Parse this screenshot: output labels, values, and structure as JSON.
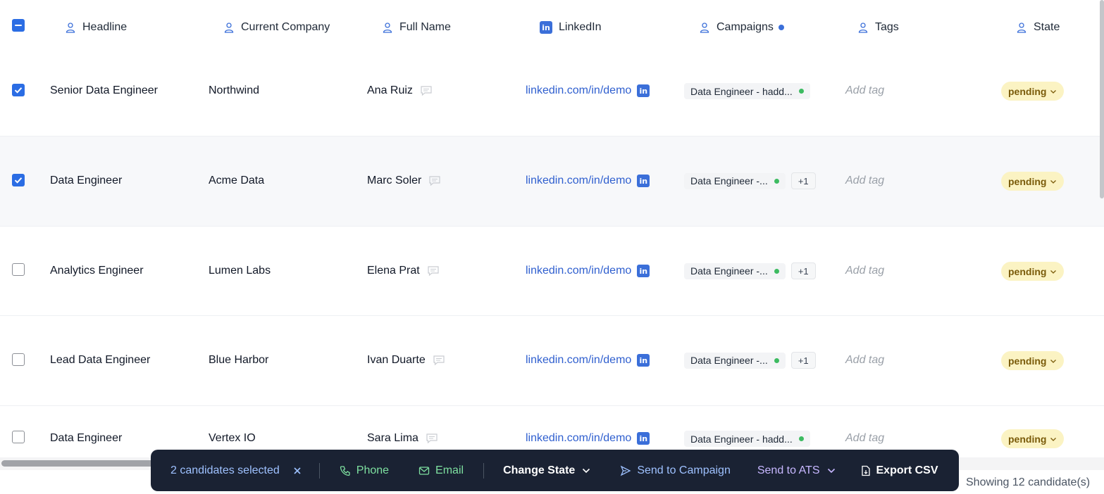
{
  "header": {
    "columns": [
      {
        "label": "Headline",
        "icon": "person-icon"
      },
      {
        "label": "Current Company",
        "icon": "person-icon"
      },
      {
        "label": "Full Name",
        "icon": "person-icon"
      },
      {
        "label": "LinkedIn",
        "icon": "linkedin-icon"
      },
      {
        "label": "Campaigns",
        "icon": "person-icon"
      },
      {
        "label": "Tags",
        "icon": "person-icon"
      },
      {
        "label": "State",
        "icon": "person-icon"
      }
    ],
    "linkedin_badge": "in"
  },
  "rows": [
    {
      "checked": true,
      "headline": "Senior Data Engineer",
      "company": "Northwind",
      "name": "Ana Ruiz",
      "linkedin": "linkedin.com/in/demo",
      "campaign": "Data Engineer - hadd...",
      "extra": "",
      "tag": "Add tag",
      "state": "pending"
    },
    {
      "checked": true,
      "headline": "Data Engineer",
      "company": "Acme Data",
      "name": "Marc Soler",
      "linkedin": "linkedin.com/in/demo",
      "campaign": "Data Engineer -...",
      "extra": "+1",
      "tag": "Add tag",
      "state": "pending"
    },
    {
      "checked": false,
      "headline": "Analytics Engineer",
      "company": "Lumen Labs",
      "name": "Elena Prat",
      "linkedin": "linkedin.com/in/demo",
      "campaign": "Data Engineer -...",
      "extra": "+1",
      "tag": "Add tag",
      "state": "pending"
    },
    {
      "checked": false,
      "headline": "Lead Data Engineer",
      "company": "Blue Harbor",
      "name": "Ivan Duarte",
      "linkedin": "linkedin.com/in/demo",
      "campaign": "Data Engineer -...",
      "extra": "+1",
      "tag": "Add tag",
      "state": "pending"
    },
    {
      "checked": false,
      "headline": "Data Engineer",
      "company": "Vertex IO",
      "name": "Sara Lima",
      "linkedin": "linkedin.com/in/demo",
      "campaign": "Data Engineer - hadd...",
      "extra": "",
      "tag": "Add tag",
      "state": "pending"
    }
  ],
  "actionbar": {
    "selected_label": "2 candidates selected",
    "phone_label": "Phone",
    "email_label": "Email",
    "change_state_label": "Change State",
    "send_campaign_label": "Send to Campaign",
    "send_ats_label": "Send to ATS",
    "export_label": "Export CSV"
  },
  "footer": {
    "showing_label": "Showing 12 candidate(s)"
  },
  "colors": {
    "accent": "#2b6de4",
    "link": "#2f5fcf",
    "status_pending_bg": "#fbf3c3",
    "campaign_active": "#3dbb61",
    "actionbar_bg": "#1a2233"
  }
}
